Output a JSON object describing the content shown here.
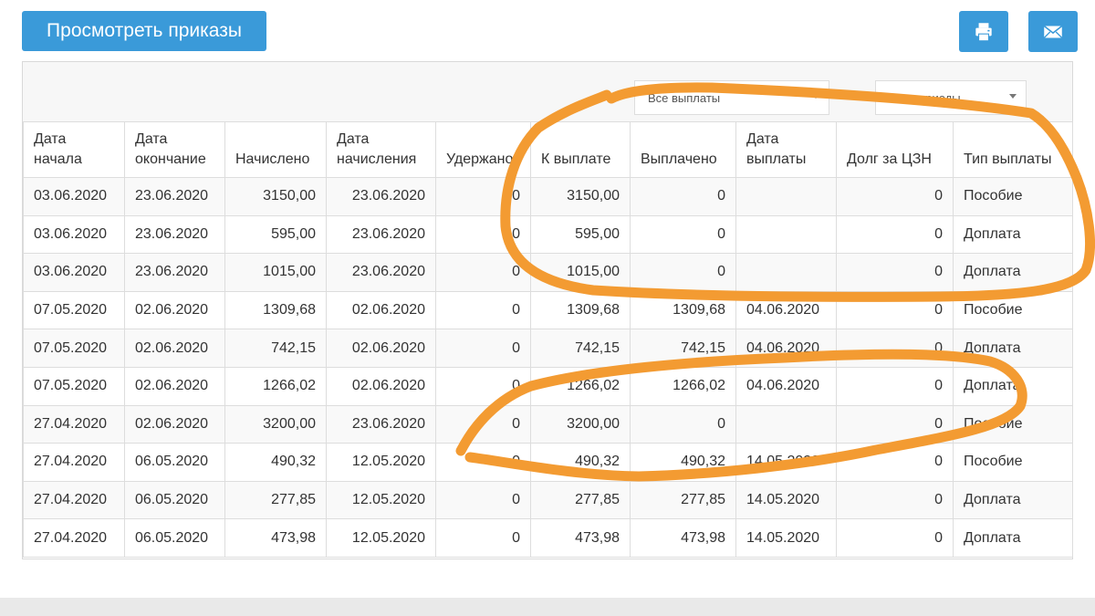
{
  "toolbar": {
    "view_orders_label": "Просмотреть приказы",
    "print_icon": "printer-icon",
    "mail_icon": "envelope-icon"
  },
  "filters": {
    "payments": "Все выплаты",
    "periods": "Все периоды"
  },
  "colors": {
    "accent": "#3a9ad9",
    "annotation": "#f39b32"
  },
  "table": {
    "columns": [
      "Дата начала",
      "Дата окончание",
      "Начислено",
      "Дата начисления",
      "Удержано",
      "К выплате",
      "Выплачено",
      "Дата выплаты",
      "Долг за ЦЗН",
      "Тип выплаты"
    ],
    "rows": [
      [
        "03.06.2020",
        "23.06.2020",
        "3150,00",
        "23.06.2020",
        "0",
        "3150,00",
        "0",
        "",
        "0",
        "Пособие"
      ],
      [
        "03.06.2020",
        "23.06.2020",
        "595,00",
        "23.06.2020",
        "0",
        "595,00",
        "0",
        "",
        "0",
        "Доплата"
      ],
      [
        "03.06.2020",
        "23.06.2020",
        "1015,00",
        "23.06.2020",
        "0",
        "1015,00",
        "0",
        "",
        "0",
        "Доплата"
      ],
      [
        "07.05.2020",
        "02.06.2020",
        "1309,68",
        "02.06.2020",
        "0",
        "1309,68",
        "1309,68",
        "04.06.2020",
        "0",
        "Пособие"
      ],
      [
        "07.05.2020",
        "02.06.2020",
        "742,15",
        "02.06.2020",
        "0",
        "742,15",
        "742,15",
        "04.06.2020",
        "0",
        "Доплата"
      ],
      [
        "07.05.2020",
        "02.06.2020",
        "1266,02",
        "02.06.2020",
        "0",
        "1266,02",
        "1266,02",
        "04.06.2020",
        "0",
        "Доплата"
      ],
      [
        "27.04.2020",
        "02.06.2020",
        "3200,00",
        "23.06.2020",
        "0",
        "3200,00",
        "0",
        "",
        "0",
        "Пособие"
      ],
      [
        "27.04.2020",
        "06.05.2020",
        "490,32",
        "12.05.2020",
        "0",
        "490,32",
        "490,32",
        "14.05.2020",
        "0",
        "Пособие"
      ],
      [
        "27.04.2020",
        "06.05.2020",
        "277,85",
        "12.05.2020",
        "0",
        "277,85",
        "277,85",
        "14.05.2020",
        "0",
        "Доплата"
      ],
      [
        "27.04.2020",
        "06.05.2020",
        "473,98",
        "12.05.2020",
        "0",
        "473,98",
        "473,98",
        "14.05.2020",
        "0",
        "Доплата"
      ]
    ]
  }
}
